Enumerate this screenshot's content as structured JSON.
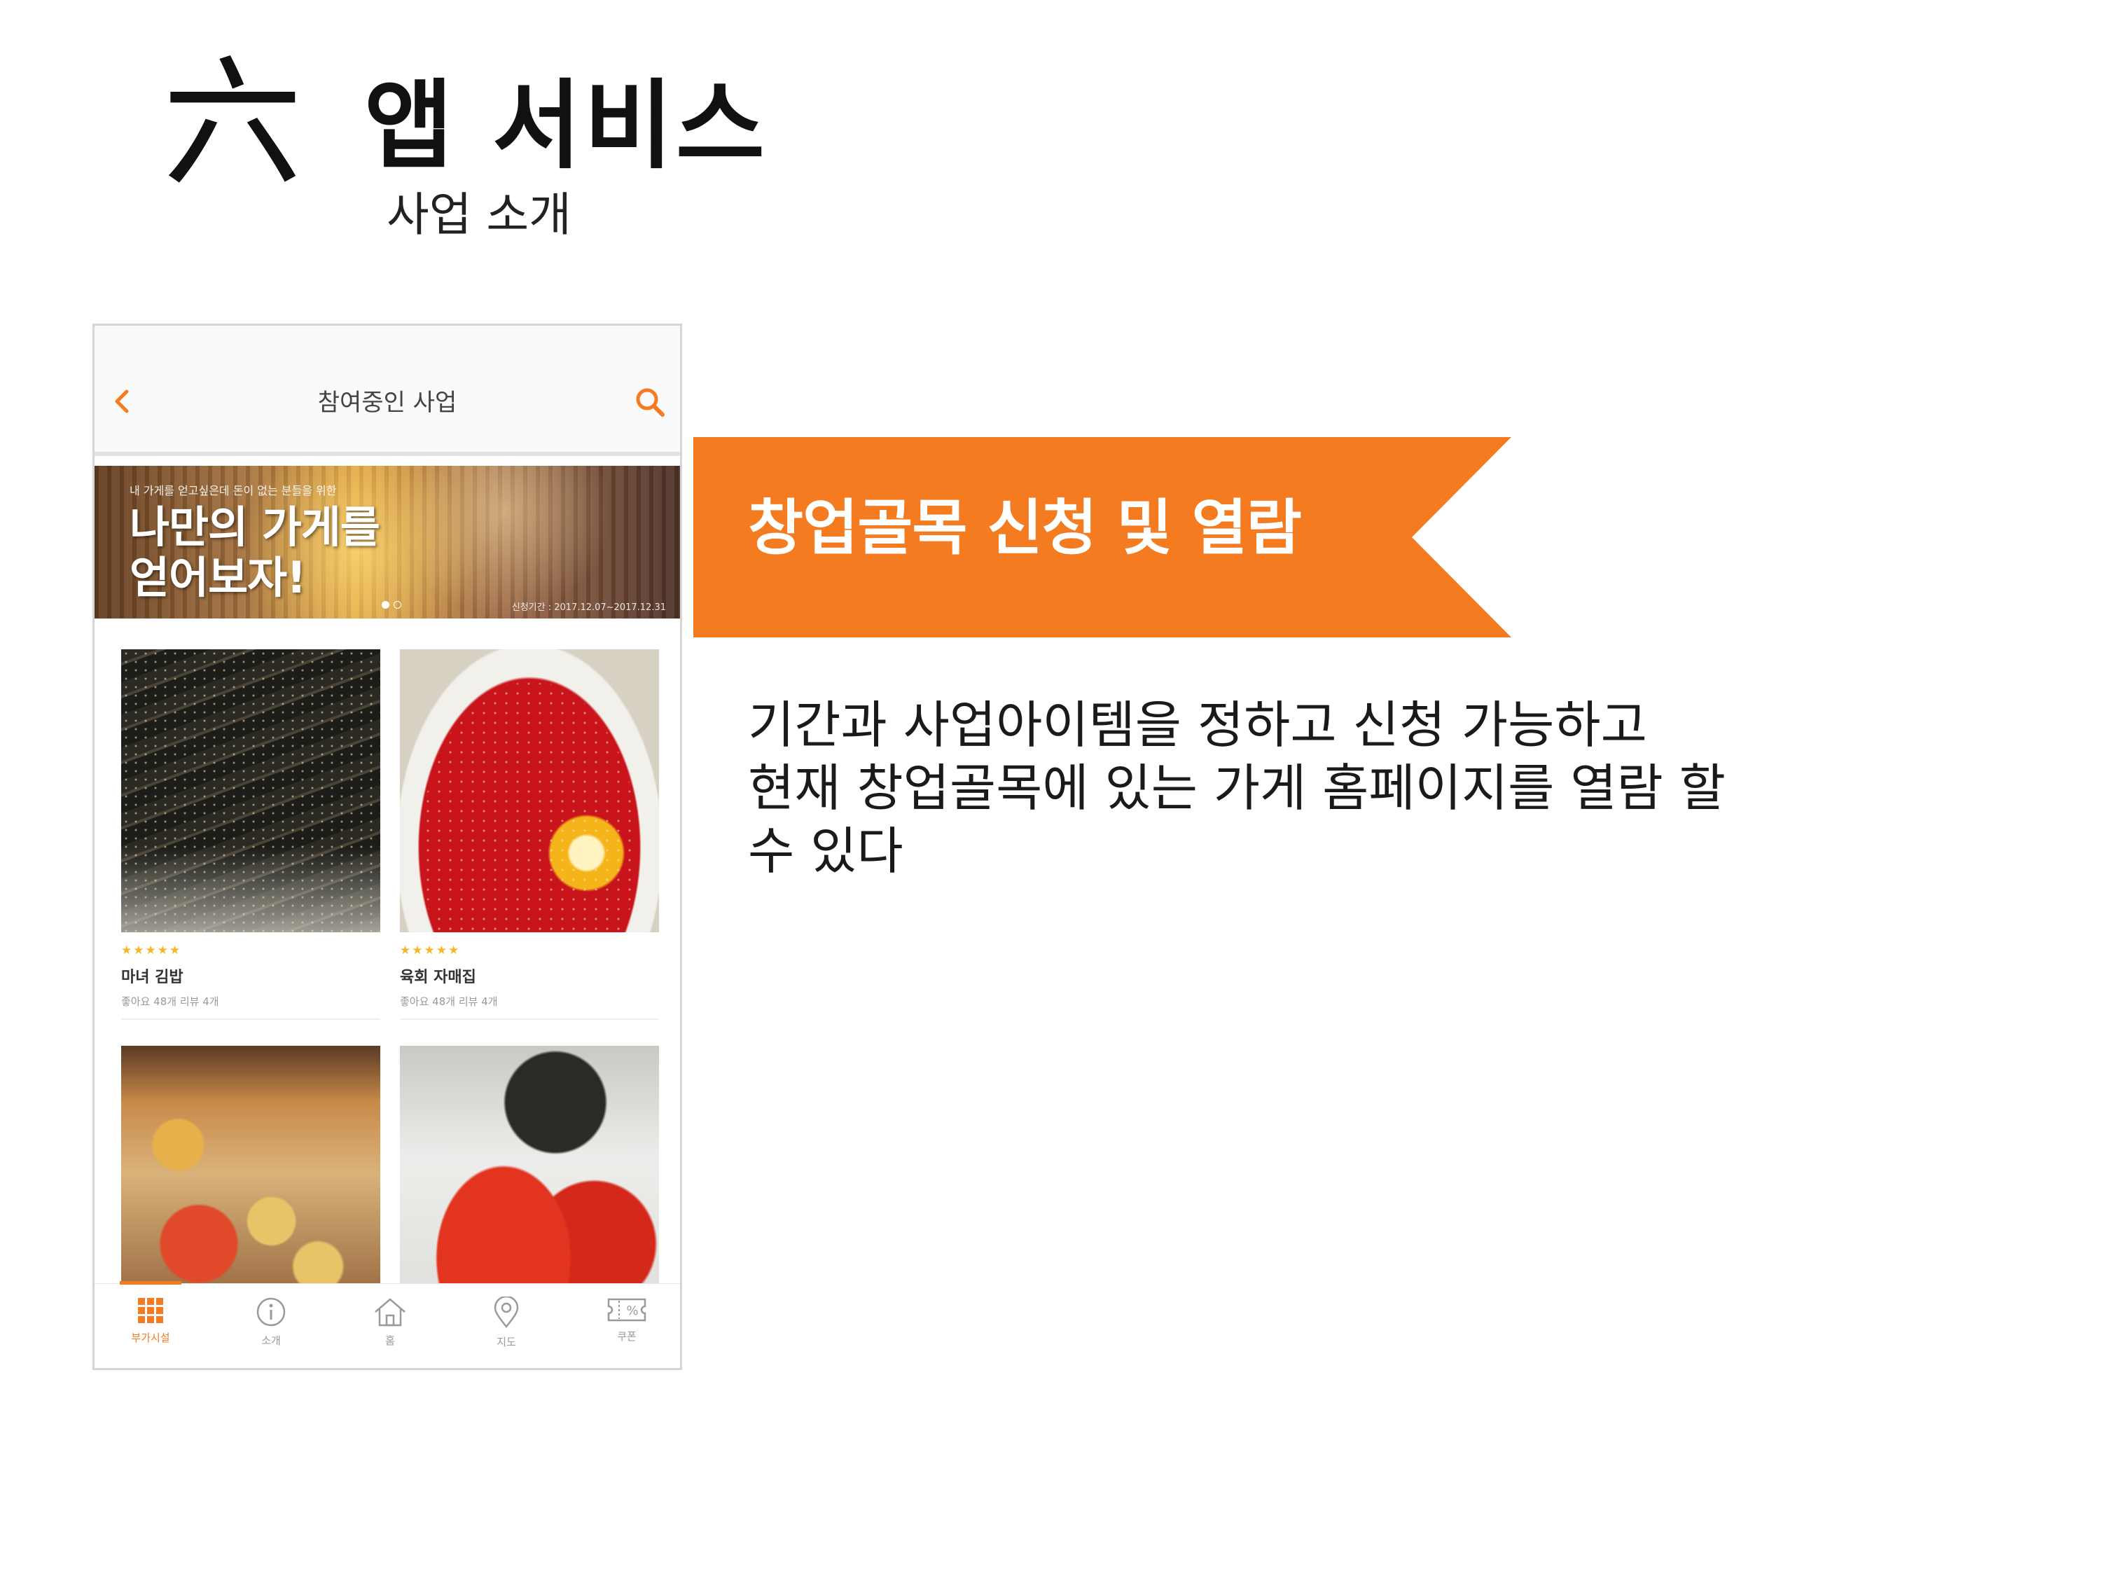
{
  "slide": {
    "hanja": "六",
    "title": "앱 서비스",
    "subtitle": "사업 소개"
  },
  "phone": {
    "header": {
      "title": "참여중인 사업",
      "back_icon": "chevron-left-icon",
      "search_icon": "search-icon"
    },
    "banner": {
      "top_text": "내 가게를 얻고싶은데 돈이 없는 분들을 위한",
      "headline_line1": "나만의 가게를",
      "headline_line2": "얻어보자!",
      "period": "신청기간 : 2017.12.07~2017.12.31",
      "slides_total": 2,
      "slide_active": 1
    },
    "stores": [
      {
        "name": "마녀 김밥",
        "meta": "좋아요 48개 리뷰 4개",
        "rating": 5
      },
      {
        "name": "육회 자매집",
        "meta": "좋아요 48개 리뷰 4개",
        "rating": 5
      },
      {
        "name": "",
        "meta": "",
        "rating": null
      },
      {
        "name": "",
        "meta": "",
        "rating": null
      }
    ],
    "tabs": [
      {
        "label": "부가시설",
        "icon": "grid-icon",
        "active": true
      },
      {
        "label": "소개",
        "icon": "info-icon",
        "active": false
      },
      {
        "label": "홈",
        "icon": "home-icon",
        "active": false
      },
      {
        "label": "지도",
        "icon": "map-pin-icon",
        "active": false
      },
      {
        "label": "쿠폰",
        "icon": "coupon-icon",
        "active": false
      }
    ]
  },
  "ribbon": {
    "text": "창업골목 신청 및 열람",
    "color": "#f47b20"
  },
  "description": {
    "line1": "기간과 사업아이템을 정하고 신청 가능하고",
    "line2": "현재 창업골목에 있는 가게 홈페이지를 열람 할",
    "line3": "수 있다"
  },
  "colors": {
    "accent": "#f47b20",
    "star": "#f7b52b"
  }
}
